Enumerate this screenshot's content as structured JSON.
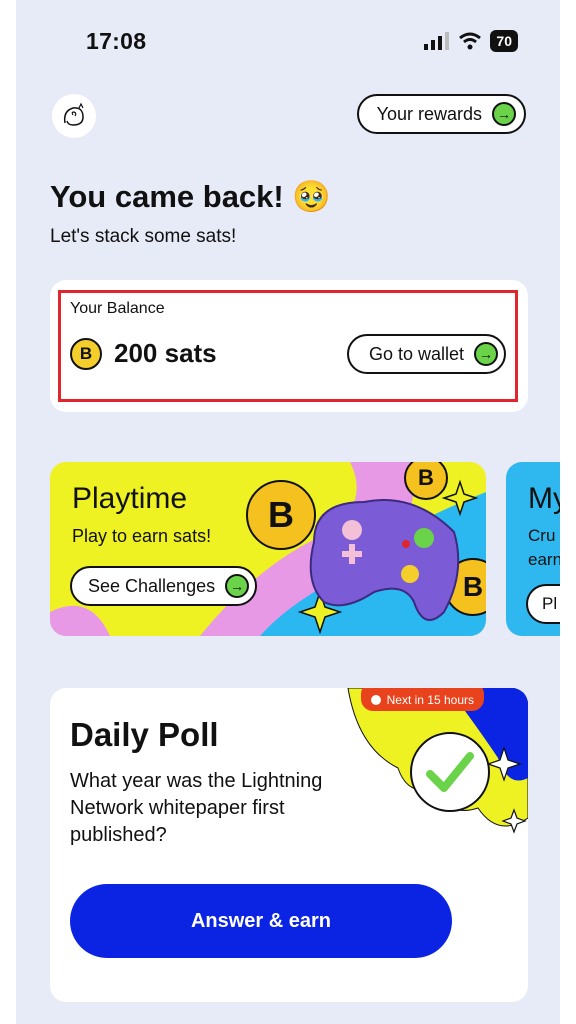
{
  "status": {
    "time": "17:08",
    "battery": "70"
  },
  "header": {
    "rewards_label": "Your rewards"
  },
  "greeting": {
    "title": "You came back! 🥹",
    "subtitle": "Let's stack some sats!"
  },
  "balance": {
    "label": "Your Balance",
    "amount": "200 sats",
    "wallet_label": "Go to wallet",
    "coin_symbol": "B"
  },
  "carousel": [
    {
      "title": "Playtime",
      "subtitle": "Play to earn sats!",
      "button": "See Challenges"
    },
    {
      "title": "My",
      "subtitle_lines": [
        "Cru",
        "earn"
      ],
      "button": "Pl"
    }
  ],
  "poll": {
    "badge": "Next in 15 hours",
    "title": "Daily Poll",
    "question": "What year was the Lightning Network whitepaper first published?",
    "answer_label": "Answer & earn"
  },
  "colors": {
    "accent_green": "#6bd34a",
    "highlight_red": "#e0262c",
    "answer_blue": "#0b24e3",
    "card_yellow": "#eef223",
    "badge_orange": "#e8431d"
  }
}
